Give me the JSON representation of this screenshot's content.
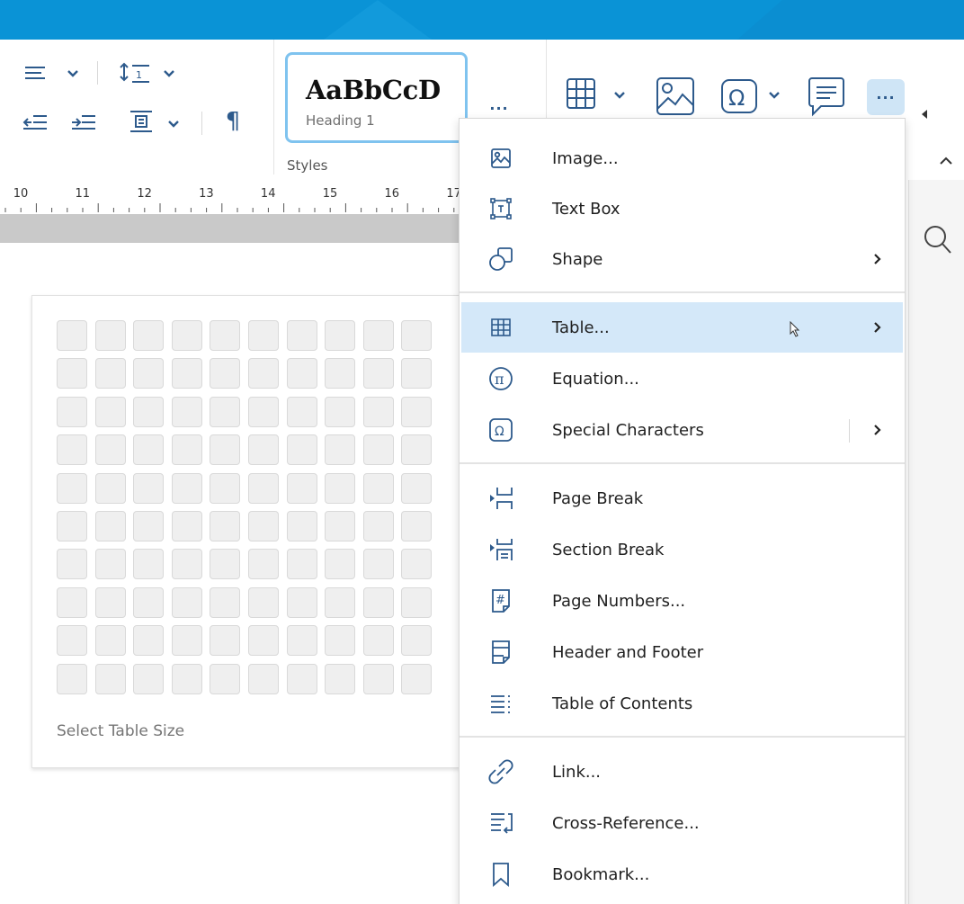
{
  "ribbon": {
    "styles": {
      "sample": "AaBbCcD",
      "style_name": "Heading 1",
      "group_label": "Styles",
      "more_label": "···"
    },
    "paragraph_mark": "¶",
    "more_label": "···"
  },
  "ruler": {
    "numbers": [
      "10",
      "11",
      "12",
      "13",
      "14",
      "15",
      "16",
      "17"
    ]
  },
  "table_picker": {
    "rows": 10,
    "cols": 10,
    "label": "Select Table Size"
  },
  "menu": {
    "items": [
      {
        "label": "Image...",
        "icon": "image-icon"
      },
      {
        "label": "Text Box",
        "icon": "text-box-icon"
      },
      {
        "label": "Shape",
        "icon": "shape-icon",
        "submenu": true
      },
      {
        "label": "Table...",
        "icon": "table-icon",
        "submenu": true,
        "highlighted": true
      },
      {
        "label": "Equation...",
        "icon": "equation-icon"
      },
      {
        "label": "Special Characters",
        "icon": "special-characters-icon",
        "submenu": true
      },
      {
        "label": "Page Break",
        "icon": "page-break-icon"
      },
      {
        "label": "Section Break",
        "icon": "section-break-icon"
      },
      {
        "label": "Page Numbers...",
        "icon": "page-numbers-icon"
      },
      {
        "label": "Header and Footer",
        "icon": "header-footer-icon"
      },
      {
        "label": "Table of Contents",
        "icon": "table-of-contents-icon"
      },
      {
        "label": "Link...",
        "icon": "link-icon"
      },
      {
        "label": "Cross-Reference...",
        "icon": "cross-reference-icon"
      },
      {
        "label": "Bookmark...",
        "icon": "bookmark-icon"
      }
    ]
  },
  "colors": {
    "title_bar": "#0a93d6",
    "icon_blue": "#2d5a8c",
    "menu_hover": "#d4e8f9",
    "style_card_border": "#7fc3ef"
  }
}
